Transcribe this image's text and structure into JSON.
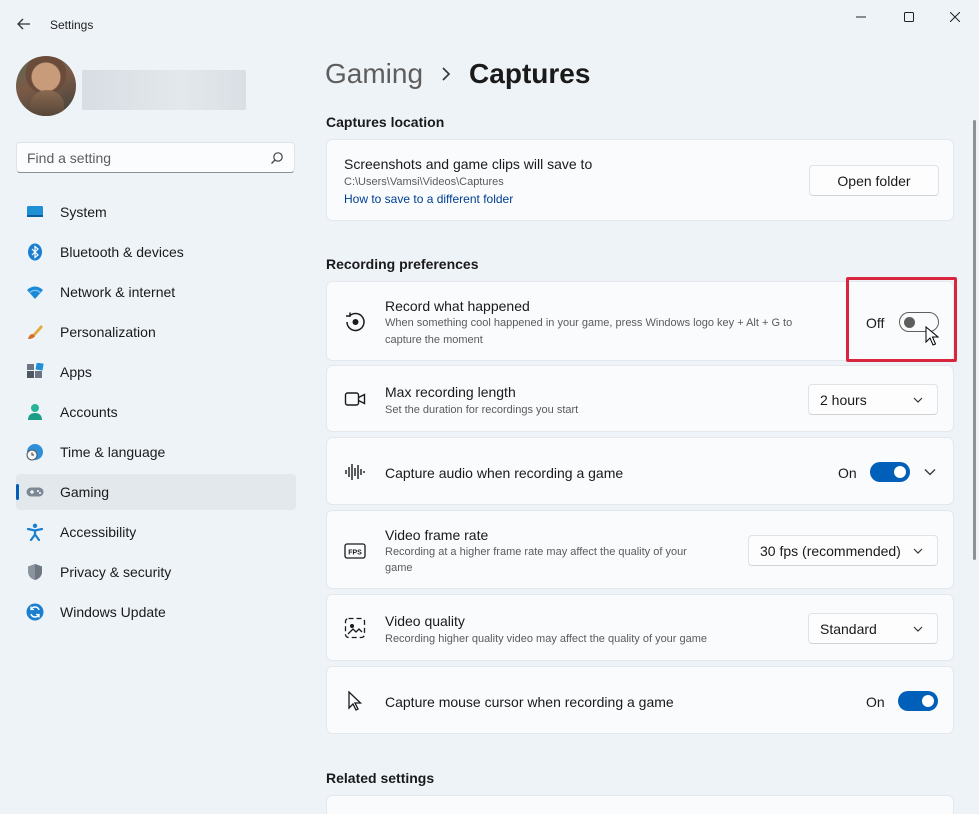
{
  "window": {
    "app_title": "Settings"
  },
  "sidebar": {
    "search_placeholder": "Find a setting",
    "items": [
      {
        "label": "System",
        "icon": "monitor-icon"
      },
      {
        "label": "Bluetooth & devices",
        "icon": "bluetooth-icon"
      },
      {
        "label": "Network & internet",
        "icon": "wifi-icon"
      },
      {
        "label": "Personalization",
        "icon": "brush-icon"
      },
      {
        "label": "Apps",
        "icon": "apps-icon"
      },
      {
        "label": "Accounts",
        "icon": "person-icon"
      },
      {
        "label": "Time & language",
        "icon": "globe-clock-icon"
      },
      {
        "label": "Gaming",
        "icon": "gamepad-icon",
        "active": true
      },
      {
        "label": "Accessibility",
        "icon": "accessibility-icon"
      },
      {
        "label": "Privacy & security",
        "icon": "shield-icon"
      },
      {
        "label": "Windows Update",
        "icon": "update-icon"
      }
    ]
  },
  "breadcrumb": {
    "parent": "Gaming",
    "current": "Captures"
  },
  "captures_location": {
    "heading": "Captures location",
    "title": "Screenshots and game clips will save to",
    "path": "C:\\Users\\Vamsi\\Videos\\Captures",
    "link": "How to save to a different folder",
    "button": "Open folder"
  },
  "recording_preferences": {
    "heading": "Recording preferences",
    "record_what_happened": {
      "title": "Record what happened",
      "desc_line1": "When something cool happened in your game, press Windows logo key + Alt + G to",
      "desc_line2": "capture the moment",
      "state_label": "Off",
      "on": false
    },
    "max_length": {
      "title": "Max recording length",
      "desc": "Set the duration for recordings you start",
      "value": "2 hours"
    },
    "capture_audio": {
      "title": "Capture audio when recording a game",
      "state_label": "On",
      "on": true
    },
    "frame_rate": {
      "title": "Video frame rate",
      "desc_line1": "Recording at a higher frame rate may affect the quality of your",
      "desc_line2": "game",
      "value": "30 fps (recommended)"
    },
    "video_quality": {
      "title": "Video quality",
      "desc": "Recording higher quality video may affect the quality of your game",
      "value": "Standard"
    },
    "capture_cursor": {
      "title": "Capture mouse cursor when recording a game",
      "state_label": "On",
      "on": true
    }
  },
  "related_settings": {
    "heading": "Related settings"
  },
  "colors": {
    "accent": "#005fb8",
    "highlight": "#d7263d"
  }
}
